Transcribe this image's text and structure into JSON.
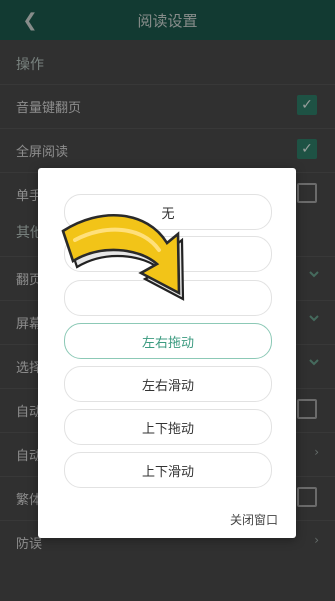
{
  "header": {
    "title": "阅读设置"
  },
  "sections": {
    "ops_title": "操作",
    "other_title": "其他"
  },
  "settings": [
    {
      "label": "音量键翻页",
      "checked": true
    },
    {
      "label": "全屏阅读",
      "checked": true
    },
    {
      "label": "单手",
      "checked": false
    },
    {
      "label": "翻页"
    },
    {
      "label": "屏幕"
    },
    {
      "label": "选择"
    },
    {
      "label": "自动"
    },
    {
      "label": "自动"
    },
    {
      "label": "繁体"
    },
    {
      "label": "防误"
    }
  ],
  "dialog": {
    "options": [
      "无",
      "仿真",
      "",
      "左右拖动",
      "左右滑动",
      "上下拖动",
      "上下滑动"
    ],
    "selected_index": 3,
    "close_label": "关闭窗口"
  },
  "colors": {
    "header_bg": "#1d5a4e",
    "accent": "#2f7f69",
    "selected_text": "#3c9b80",
    "arrow_yellow": "#f2c418"
  }
}
